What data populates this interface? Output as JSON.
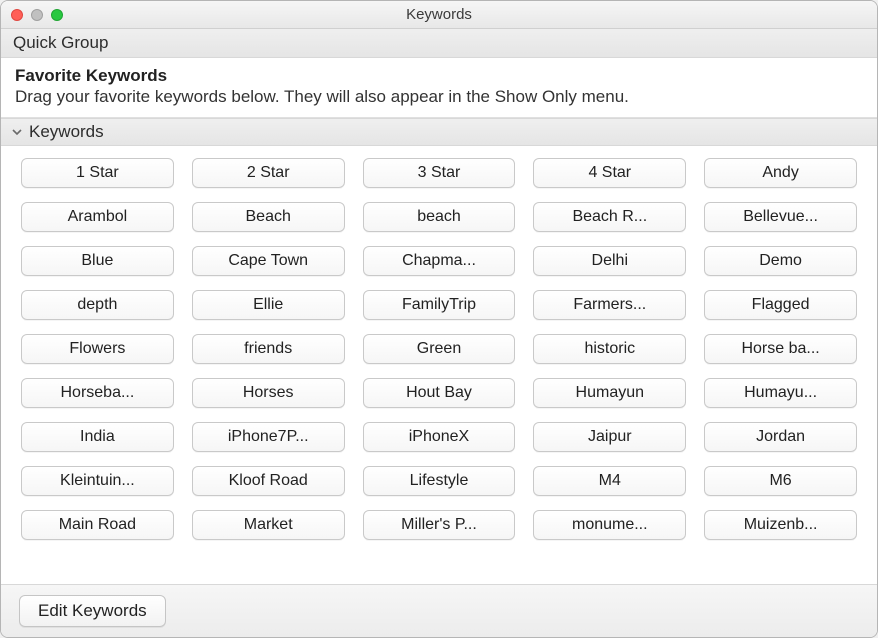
{
  "window": {
    "title": "Keywords"
  },
  "quick_group": {
    "label": "Quick Group"
  },
  "favorites": {
    "title": "Favorite Keywords",
    "description": "Drag your favorite keywords below. They will also appear in the Show Only menu."
  },
  "keywords_section": {
    "label": "Keywords"
  },
  "keywords": [
    "1 Star",
    "2 Star",
    "3 Star",
    "4 Star",
    "Andy",
    "Arambol",
    "Beach",
    "beach",
    "Beach R...",
    "Bellevue...",
    "Blue",
    "Cape Town",
    "Chapma...",
    "Delhi",
    "Demo",
    "depth",
    "Ellie",
    "FamilyTrip",
    "Farmers...",
    "Flagged",
    "Flowers",
    "friends",
    "Green",
    "historic",
    "Horse ba...",
    "Horseba...",
    "Horses",
    "Hout Bay",
    "Humayun",
    "Humayu...",
    "India",
    "iPhone7P...",
    "iPhoneX",
    "Jaipur",
    "Jordan",
    "Kleintuin...",
    "Kloof Road",
    "Lifestyle",
    "M4",
    "M6",
    "Main Road",
    "Market",
    "Miller's P...",
    "monume...",
    "Muizenb..."
  ],
  "footer": {
    "edit_label": "Edit Keywords"
  }
}
